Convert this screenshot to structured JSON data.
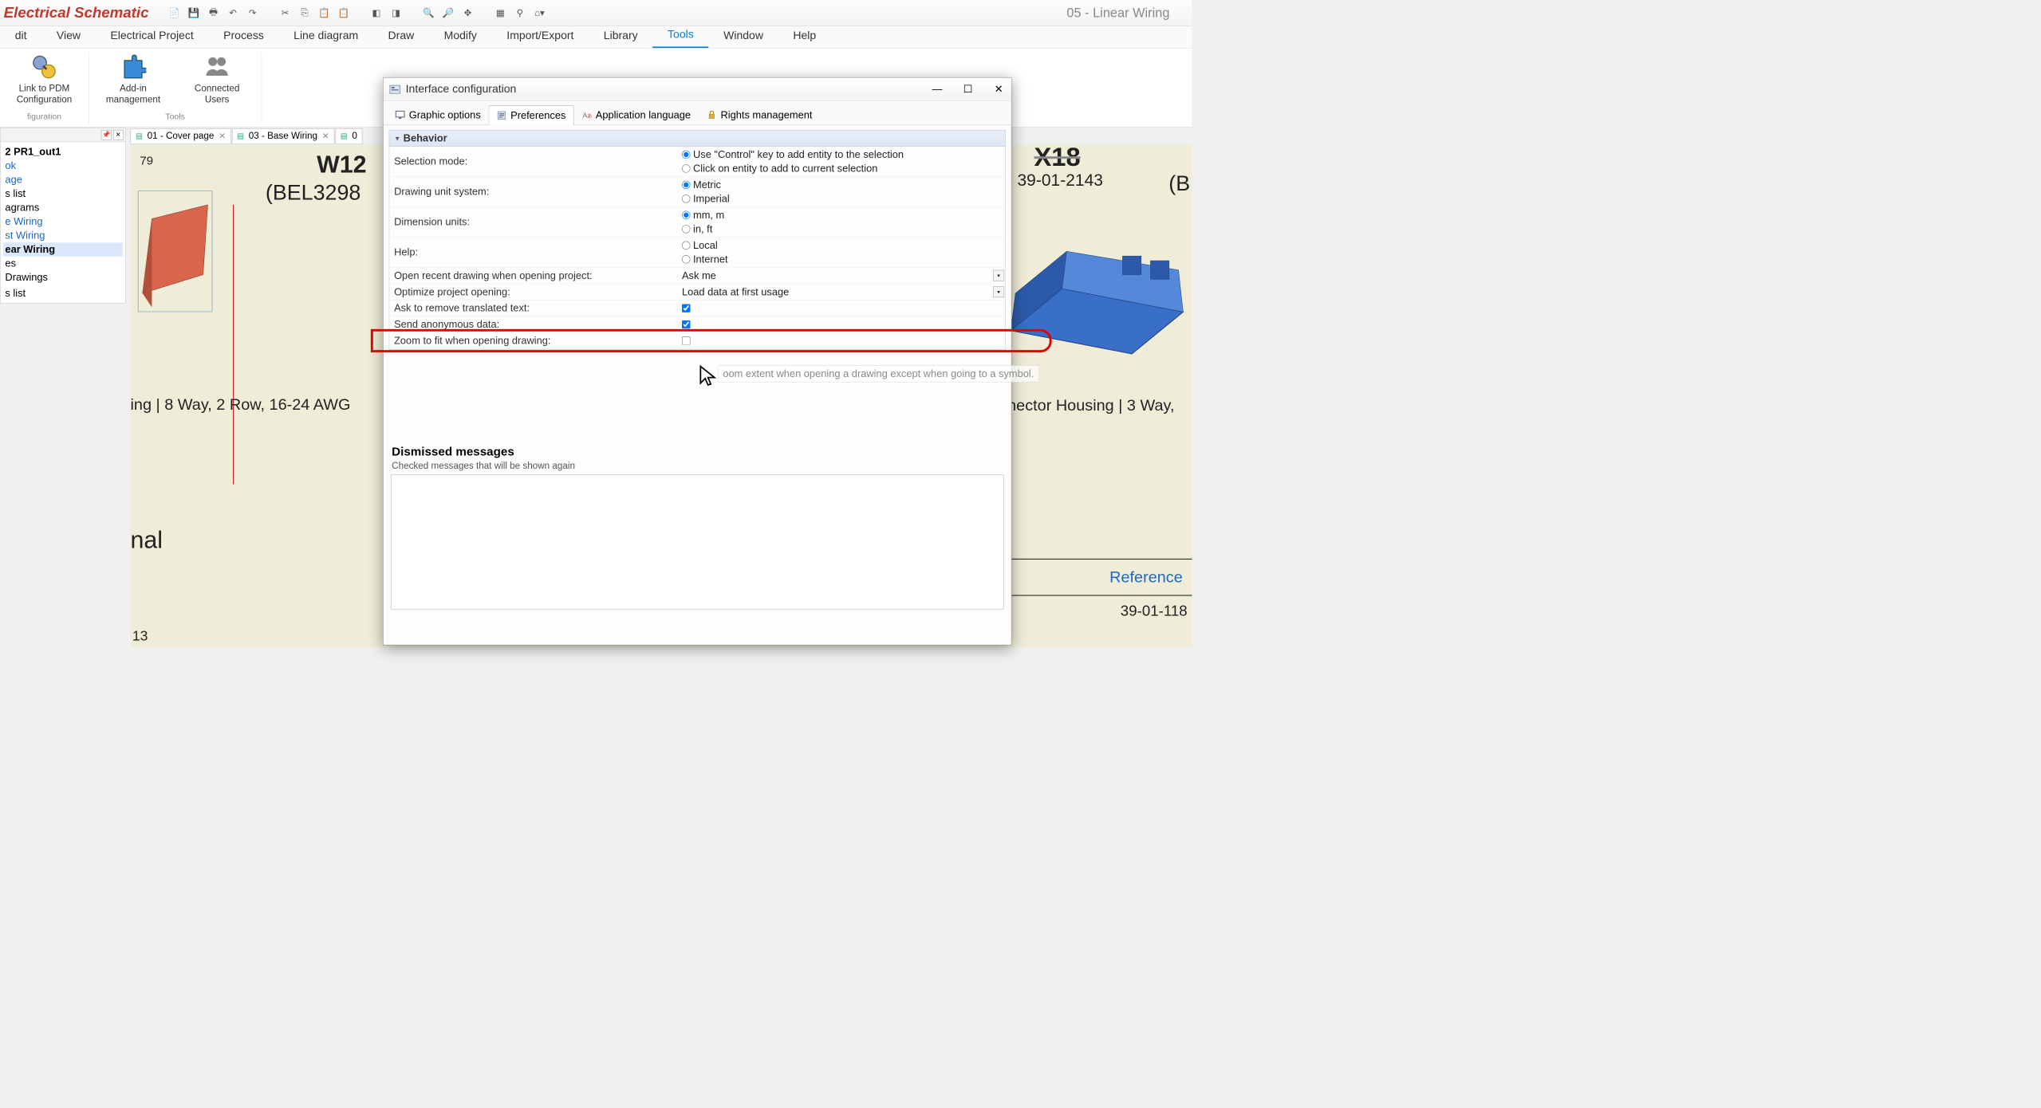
{
  "app": {
    "title": "Electrical Schematic",
    "doc_title_right": "05 - Linear Wiring"
  },
  "menu": {
    "items": [
      "dit",
      "View",
      "Electrical Project",
      "Process",
      "Line diagram",
      "Draw",
      "Modify",
      "Import/Export",
      "Library",
      "Tools",
      "Window",
      "Help"
    ],
    "active_index": 9
  },
  "ribbon": {
    "groups": [
      {
        "label": "figuration",
        "items": [
          {
            "label": "Link to PDM Configuration"
          }
        ]
      },
      {
        "label": "Tools",
        "items": [
          {
            "label": "Add-in management"
          },
          {
            "label": "Connected Users"
          }
        ]
      }
    ]
  },
  "sidepanel": {
    "items": [
      {
        "t": "2 PR1_out1",
        "bold": true
      },
      {
        "t": "ok",
        "link": true
      },
      {
        "t": "age",
        "link": true
      },
      {
        "t": "s list"
      },
      {
        "t": "agrams"
      },
      {
        "t": "e Wiring",
        "link": true
      },
      {
        "t": "st Wiring",
        "link": true
      },
      {
        "t": "ear Wiring",
        "bold": true,
        "sel": true
      },
      {
        "t": "es"
      },
      {
        "t": "Drawings"
      },
      {
        "t": ""
      },
      {
        "t": "s list"
      }
    ]
  },
  "tabs": [
    {
      "label": "01 - Cover page"
    },
    {
      "label": "03 - Base Wiring"
    },
    {
      "label": "0"
    }
  ],
  "canvas": {
    "leftnum": "79",
    "w": "W12",
    "bel": "(BEL3298",
    "desc": "ing | 8 Way, 2 Row, 16-24 AWG",
    "nal": "nal",
    "l13": "13",
    "x18": "X18",
    "partnum": "39-01-2143",
    "bref": "(B",
    "rdesc": "nnector Housing | 3 Way,",
    "reference": "Reference",
    "refnum": "39-01-118"
  },
  "dialog": {
    "title": "Interface configuration",
    "tabs": [
      "Graphic options",
      "Preferences",
      "Application language",
      "Rights management"
    ],
    "active_tab": 1,
    "section": "Behavior",
    "rows": {
      "selection_mode": "Selection mode:",
      "sel_opt1": "Use \"Control\" key to add entity to the selection",
      "sel_opt2": "Click on entity to add to current selection",
      "drawing_unit": "Drawing unit system:",
      "metric": "Metric",
      "imperial": "Imperial",
      "dim_units": "Dimension units:",
      "mm": "mm, m",
      "inft": "in, ft",
      "help": "Help:",
      "local": "Local",
      "internet": "Internet",
      "open_recent": "Open recent drawing when opening project:",
      "ask_me": "Ask me",
      "optimize": "Optimize project opening:",
      "load_first": "Load data at first usage",
      "ask_trans": "Ask to remove translated text:",
      "send_anon": "Send anonymous data:",
      "zoom_fit": "Zoom to fit when opening drawing:"
    },
    "tooltip": "oom extent when opening a drawing except when going to a symbol.",
    "dismissed_head": "Dismissed messages",
    "dismissed_sub": "Checked messages that will be shown again"
  }
}
